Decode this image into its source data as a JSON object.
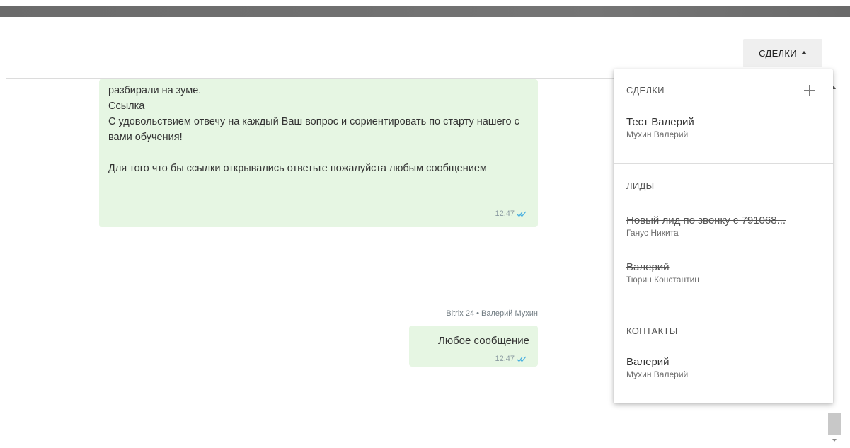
{
  "header": {
    "deals_button_label": "СДЕЛКИ"
  },
  "chat": {
    "messages": [
      {
        "text": "разбирали на зуме.\nСсылка\nС удовольствием отвечу на каждый Ваш вопрос и сориентировать по старту нашего с вами обучения!\n\nДля того что бы ссылки открывались ответьте пожалуйста любым сообщением",
        "time": "12:47"
      },
      {
        "sender": "Bitrix 24 • Валерий Мухин",
        "text": "Любое сообщение",
        "time": "12:47"
      }
    ]
  },
  "panel": {
    "deals": {
      "title": "СДЕЛКИ",
      "items": [
        {
          "title": "Тест Валерий",
          "subtitle": "Мухин Валерий"
        }
      ]
    },
    "leads": {
      "title": "ЛИДЫ",
      "items": [
        {
          "title": "Новый лид по звонку с 791068...",
          "subtitle": "Ганус Никита"
        },
        {
          "title": "Валерий",
          "subtitle": "Тюрин Константин"
        }
      ]
    },
    "contacts": {
      "title": "КОНТАКТЫ",
      "items": [
        {
          "title": "Валерий",
          "subtitle": "Мухин Валерий"
        }
      ]
    }
  },
  "colors": {
    "bubble": "#e6f6e3",
    "read_check": "#4ab0e0"
  },
  "icons": {
    "read_receipt": "double-check-icon",
    "add": "plus-icon",
    "dropdown_caret": "caret-up-icon"
  }
}
